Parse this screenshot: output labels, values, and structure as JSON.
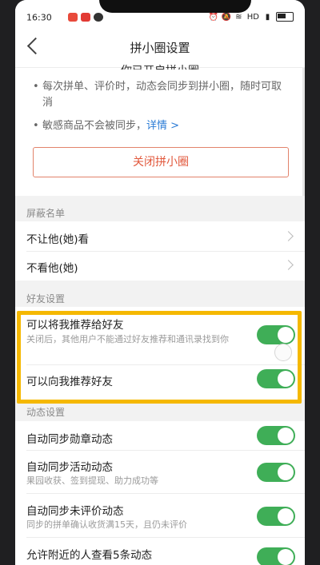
{
  "status": {
    "time": "16:30",
    "network": "HD",
    "left_icons": [
      "weibo-icon",
      "app-badge-icon",
      "video-icon"
    ],
    "right_icons": [
      "alarm-icon",
      "mute-icon",
      "wifi-icon",
      "signal-icon",
      "battery-icon"
    ]
  },
  "nav": {
    "title": "拼小圈设置"
  },
  "intro": {
    "cut_title": "你已开启拼小圈",
    "bullet1": "每次拼单、评价时，动态会同步到拼小圈，随时可取消",
    "bullet2_text": "敏感商品不会被同步，",
    "bullet2_link": "详情 >",
    "close_button": "关闭拼小圈"
  },
  "blocklist": {
    "section_title": "屏蔽名单",
    "item1": "不让他(她)看",
    "item2": "不看他(她)"
  },
  "friends": {
    "section_title": "好友设置",
    "item1_title": "可以将我推荐给好友",
    "item1_desc": "关闭后，其他用户不能通过好友推荐和通讯录找到你",
    "item1_on": true,
    "item2_title": "可以向我推荐好友",
    "item2_on": true
  },
  "dynamics": {
    "section_title": "动态设置",
    "item1_title": "自动同步勋章动态",
    "item2_title": "自动同步活动动态",
    "item2_desc": "果园收获、签到提现、助力成功等",
    "item3_title": "自动同步未评价动态",
    "item3_desc": "同步的拼单确认收货满15天，且仍未评价",
    "item4_title": "允许附近的人查看5条动态"
  },
  "colors": {
    "toggle_on": "#3fae57",
    "accent": "#e2583c",
    "link": "#2b7cd6",
    "highlight": "#f5b800"
  }
}
